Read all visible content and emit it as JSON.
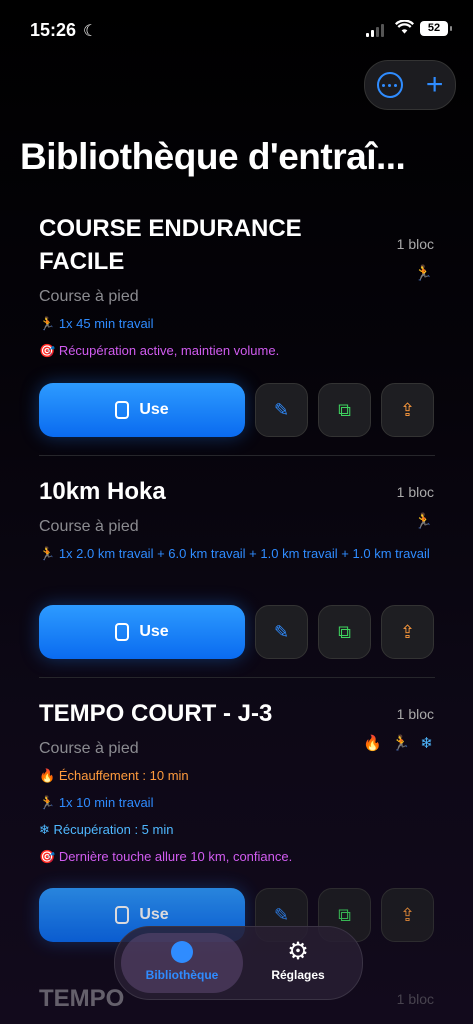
{
  "status": {
    "time": "15:26",
    "battery": "52"
  },
  "header": {
    "title": "Bibliothèque d'entraî..."
  },
  "workouts": [
    {
      "name": "COURSE ENDURANCE FACILE",
      "blocks": "1 bloc",
      "sport": "Course à pied",
      "lines": [
        {
          "text": "1x 45 min travail",
          "color": "blue"
        },
        {
          "text": "Récupération active, maintien volume.",
          "color": "purple"
        }
      ],
      "use_label": "Use"
    },
    {
      "name": "10km Hoka",
      "blocks": "1 bloc",
      "sport": "Course à pied",
      "lines": [
        {
          "text": "1x 2.0 km travail + 6.0 km travail + 1.0 km travail + 1.0 km travail",
          "color": "blue"
        }
      ],
      "use_label": "Use"
    },
    {
      "name": "TEMPO COURT - J-3",
      "blocks": "1 bloc",
      "sport": "Course à pied",
      "lines": [
        {
          "text": "Échauffement : 10 min",
          "color": "orange"
        },
        {
          "text": "1x 10 min travail",
          "color": "blue"
        },
        {
          "text": "Récupération : 5 min",
          "color": "cyan"
        },
        {
          "text": "Dernière touche allure 10 km, confiance.",
          "color": "purple"
        }
      ],
      "use_label": "Use"
    },
    {
      "name": "TEMPO",
      "blocks": "1 bloc"
    }
  ],
  "tabs": {
    "library": "Bibliothèque",
    "settings": "Réglages"
  }
}
